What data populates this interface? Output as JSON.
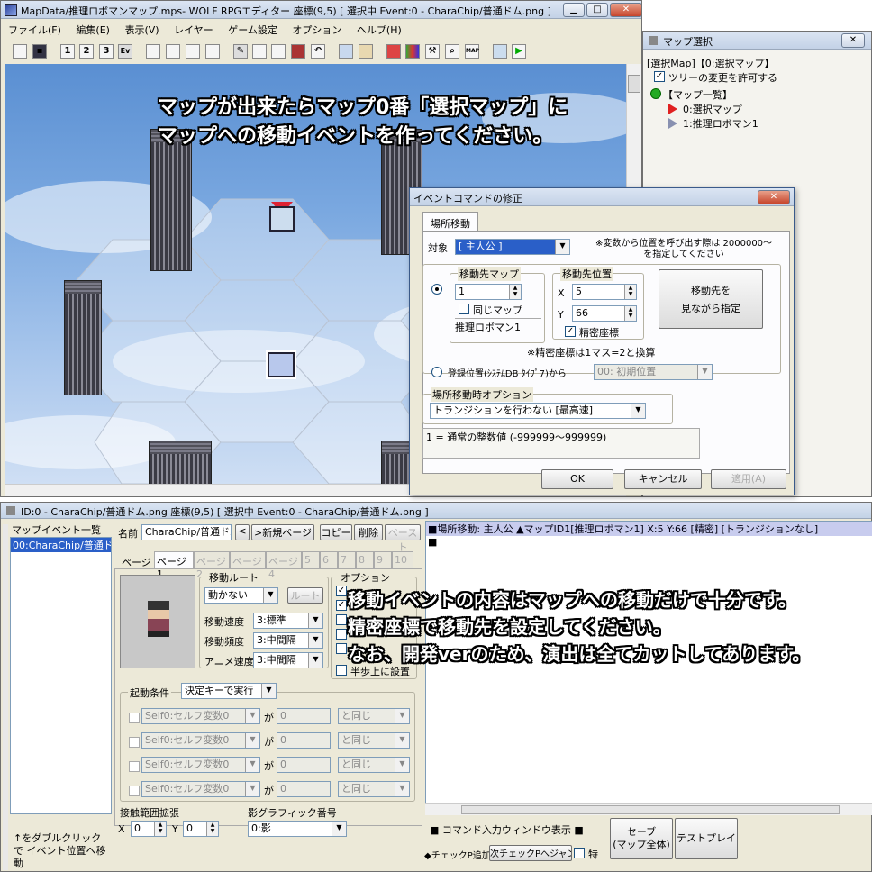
{
  "main_window": {
    "title": "MapData/推理ロボマンマップ.mps- WOLF RPGエディター 座標(9,5) [ 選択中 Event:0 - CharaChip/普通ドム.png ]",
    "menu": [
      "ファイル(F)",
      "編集(E)",
      "表示(V)",
      "レイヤー",
      "ゲーム設定",
      "オプション",
      "ヘルプ(H)"
    ],
    "toolbar_layers": [
      "1",
      "2",
      "3",
      "Ev"
    ]
  },
  "map_overlay": {
    "line1": "マップが出来たらマップ0番「選択マップ」に",
    "line2": "マップへの移動イベントを作ってください。"
  },
  "map_select": {
    "title": "マップ選択",
    "header": "[選択Map]【0:選択マップ】",
    "allow_tree_change": "ツリーの変更を許可する",
    "root": "【マップ一覧】",
    "items": [
      "0:選択マップ",
      "1:推理ロボマン1"
    ]
  },
  "dialog": {
    "title": "イベントコマンドの修正",
    "tab": "場所移動",
    "target_label": "対象",
    "target_value": "[ 主人公 ]",
    "note": "※変数から位置を呼び出す際は 2000000～を指定してください",
    "dest_map_label": "移動先マップ",
    "dest_map_value": "1",
    "same_map": "同じマップ",
    "map_name": "推理ロボマン1",
    "dest_pos_label": "移動先位置",
    "x_label": "X",
    "x_value": "5",
    "y_label": "Y",
    "y_value": "66",
    "precise": "精密座標",
    "view_button_line1": "移動先を",
    "view_button_line2": "見ながら指定",
    "precise_note": "※精密座標は1マス=2と換算",
    "registered_label": "登録位置(ｼｽﾃﾑDB ﾀｲﾌﾟ7)から",
    "registered_value": "00: 初期位置",
    "option_label": "場所移動時オプション",
    "transition_value": "トランジションを行わない [最高速]",
    "info": "1 = 通常の整数値 (-999999～999999)",
    "ok": "OK",
    "cancel": "キャンセル",
    "apply": "適用(A)"
  },
  "event_window": {
    "title": "ID:0 - CharaChip/普通ドム.png 座標(9,5) [ 選択中 Event:0 - CharaChip/普通ドム.png ]",
    "list_label": "マップイベント一覧",
    "list_item": "00:CharaChip/普通ド",
    "list_hint": "↑をダブルクリックで イベント位置へ移動",
    "name_label": "名前",
    "name_value": "CharaChip/普通ドム",
    "prev": "<",
    "new_page": ">新規ページ",
    "copy": "コピー",
    "delete": "削除",
    "paste": "ペースト",
    "page_label": "ページ",
    "pages": [
      "ページ1",
      "ページ2",
      "ページ3",
      "ページ4",
      "5",
      "6",
      "7",
      "8",
      "9",
      "10"
    ],
    "route_label": "移動ルート",
    "move_type": "動かない",
    "route_button": "ルート",
    "speed_label": "移動速度",
    "speed_value": "3:標準",
    "freq_label": "移動頻度",
    "freq_value": "3:中間隔",
    "anim_label": "アニメ速度",
    "anim_value": "3:中間隔",
    "options_label": "オプション",
    "half_step": "半歩上に設置",
    "trigger_label": "起動条件",
    "trigger_value": "決定キーで実行",
    "cond_var": "Self0:セルフ変数0",
    "cond_ga": "が",
    "cond_val": "0",
    "cond_cmp": "と同じ",
    "contact_label": "接触範囲拡張",
    "cx_label": "X",
    "cx_value": "0",
    "cy_label": "Y",
    "cy_value": "0",
    "shadow_label": "影グラフィック番号",
    "shadow_value": "0:影",
    "command_line": "■場所移動: 主人公 ▲マップID1[推理ロボマン1] X:5 Y:66 [精密] [トランジションなし]",
    "command_end": "■",
    "cmd_input": "■ コマンド入力ウィンドウ表示 ■",
    "save_line1": "セーブ",
    "save_line2": "(マップ全体)",
    "testplay": "テストプレイ",
    "add_checkpoint": "◆チェックP追加",
    "next_checkpoint": "次チェックPへジャンプ",
    "special": "特"
  },
  "instructions": {
    "line1": "移動イベントの内容はマップへの移動だけで十分です。",
    "line2": "精密座標で移動先を設定してください。",
    "line3": "なお、開発verのため、演出は全てカットしてあります。"
  }
}
